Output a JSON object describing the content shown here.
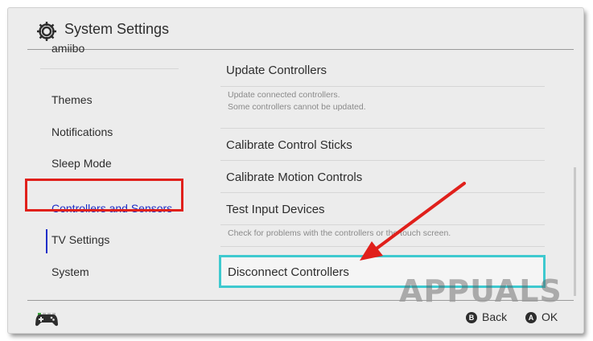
{
  "header": {
    "title": "System Settings",
    "icon": "gear-icon"
  },
  "sidebar": {
    "cut_item": "amiibo",
    "items": [
      {
        "label": "Themes"
      },
      {
        "label": "Notifications"
      },
      {
        "label": "Sleep Mode"
      },
      {
        "label": "Controllers and Sensors",
        "selected": true
      },
      {
        "label": "TV Settings"
      },
      {
        "label": "System"
      }
    ]
  },
  "content": {
    "items": [
      {
        "label": "Update Controllers",
        "description": [
          "Update connected controllers.",
          "Some controllers cannot be updated."
        ]
      },
      {
        "label": "Calibrate Control Sticks"
      },
      {
        "label": "Calibrate Motion Controls"
      },
      {
        "label": "Test Input Devices",
        "description": [
          "Check for problems with the controllers or the touch screen."
        ]
      },
      {
        "label": "Disconnect Controllers",
        "focused": true
      }
    ]
  },
  "footer": {
    "back": {
      "button": "B",
      "label": "Back"
    },
    "ok": {
      "button": "A",
      "label": "OK"
    }
  },
  "watermark": "APPUALS",
  "colors": {
    "selected_text": "#1f2fc8",
    "focus_border": "#3ec9cf",
    "annotation_red": "#e0201b"
  }
}
